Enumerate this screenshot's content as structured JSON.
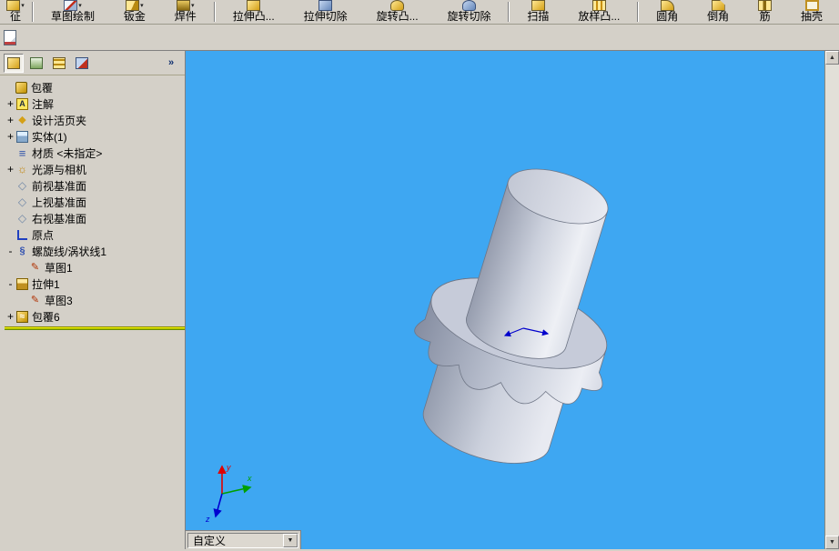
{
  "glyphs": {
    "dropdown": "▾",
    "combo_arrow": "▼",
    "scroll_up": "▲",
    "scroll_down": "▼",
    "panel_expand": "»"
  },
  "toolbar": {
    "items": [
      {
        "label": "征",
        "icon": "features-icon",
        "arrow": true
      },
      {
        "label": "草图绘制",
        "icon": "sketch-draw-icon",
        "arrow": true
      },
      {
        "label": "钣金",
        "icon": "sheet-metal-icon",
        "arrow": true
      },
      {
        "label": "焊件",
        "icon": "weldment-icon",
        "arrow": true
      },
      {
        "label": "拉伸凸...",
        "icon": "extrude-boss-icon",
        "arrow": false
      },
      {
        "label": "拉伸切除",
        "icon": "extrude-cut-icon",
        "arrow": false
      },
      {
        "label": "旋转凸...",
        "icon": "revolve-boss-icon",
        "arrow": false
      },
      {
        "label": "旋转切除",
        "icon": "revolve-cut-icon",
        "arrow": false
      },
      {
        "label": "扫描",
        "icon": "sweep-icon",
        "arrow": false
      },
      {
        "label": "放样凸...",
        "icon": "loft-icon",
        "arrow": false
      },
      {
        "label": "圆角",
        "icon": "fillet-icon",
        "arrow": false
      },
      {
        "label": "倒角",
        "icon": "chamfer-icon",
        "arrow": false
      },
      {
        "label": "筋",
        "icon": "rib-icon",
        "arrow": false
      },
      {
        "label": "抽壳",
        "icon": "shell-icon",
        "arrow": false
      }
    ]
  },
  "toolbar2": {
    "icons": [
      "document-icon"
    ]
  },
  "panel": {
    "tabs": [
      {
        "icon": "feature-tree-icon"
      },
      {
        "icon": "property-manager-icon"
      },
      {
        "icon": "configuration-manager-icon"
      },
      {
        "icon": "third-party-icon"
      }
    ]
  },
  "tree": {
    "root": "包覆",
    "items": [
      {
        "label": "注解",
        "expand": "+",
        "indent": 1,
        "icon": "annotation-icon"
      },
      {
        "label": "设计活页夹",
        "expand": "+",
        "indent": 1,
        "icon": "design-binder-icon"
      },
      {
        "label": "实体(1)",
        "expand": "+",
        "indent": 1,
        "icon": "solid-bodies-icon"
      },
      {
        "label": "材质 <未指定>",
        "expand": "",
        "indent": 1,
        "icon": "material-icon"
      },
      {
        "label": "光源与相机",
        "expand": "+",
        "indent": 1,
        "icon": "lights-icon"
      },
      {
        "label": "前视基准面",
        "expand": "",
        "indent": 1,
        "icon": "plane-icon"
      },
      {
        "label": "上视基准面",
        "expand": "",
        "indent": 1,
        "icon": "plane-icon"
      },
      {
        "label": "右视基准面",
        "expand": "",
        "indent": 1,
        "icon": "plane-icon"
      },
      {
        "label": "原点",
        "expand": "",
        "indent": 1,
        "icon": "origin-icon"
      },
      {
        "label": "螺旋线/涡状线1",
        "expand": "-",
        "indent": 1,
        "icon": "helix-icon"
      },
      {
        "label": "草图1",
        "expand": "",
        "indent": 2,
        "icon": "sketch-icon"
      },
      {
        "label": "拉伸1",
        "expand": "-",
        "indent": 1,
        "icon": "extrude-icon"
      },
      {
        "label": "草图3",
        "expand": "",
        "indent": 2,
        "icon": "sketch-icon"
      },
      {
        "label": "包覆6",
        "expand": "+",
        "indent": 1,
        "icon": "wrap-icon"
      }
    ]
  },
  "viewport": {
    "background_color": "#3EA7F2",
    "model": {
      "name": "bevel-gear-part",
      "body_color": "#C9CEDC"
    },
    "view_combo": {
      "value": "自定义"
    },
    "triad": {
      "labels": {
        "x": "x",
        "y": "y",
        "z": "z"
      },
      "colors": {
        "x": "#00A000",
        "y": "#E00000",
        "z": "#0000D0"
      }
    }
  }
}
